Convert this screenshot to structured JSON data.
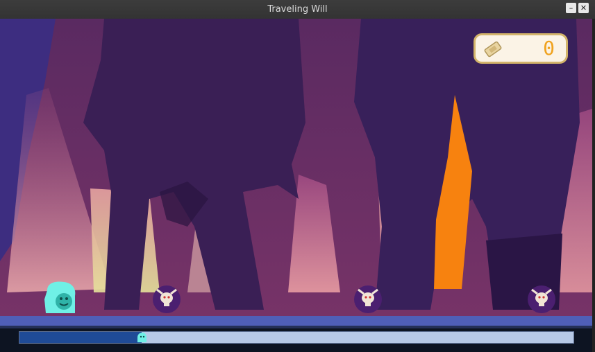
{
  "window": {
    "title": "Traveling Will",
    "minimize_symbol": "–",
    "close_symbol": "✕"
  },
  "hud": {
    "ticket_icon": "ticket-icon",
    "score": "0"
  },
  "level": {
    "progress": 0.22,
    "player": {
      "icon": "ghost-will",
      "color": "#6ff0e6"
    },
    "enemies": [
      {
        "icon": "horned-skull-blob"
      },
      {
        "icon": "horned-skull-blob"
      },
      {
        "icon": "horned-skull-blob"
      }
    ]
  },
  "colors": {
    "sky": "#6e2f63",
    "ground": "#4f5fb8",
    "progress_fill": "#1f4b97",
    "progress_track": "#b7c9e6",
    "score": "#f0a21e"
  }
}
